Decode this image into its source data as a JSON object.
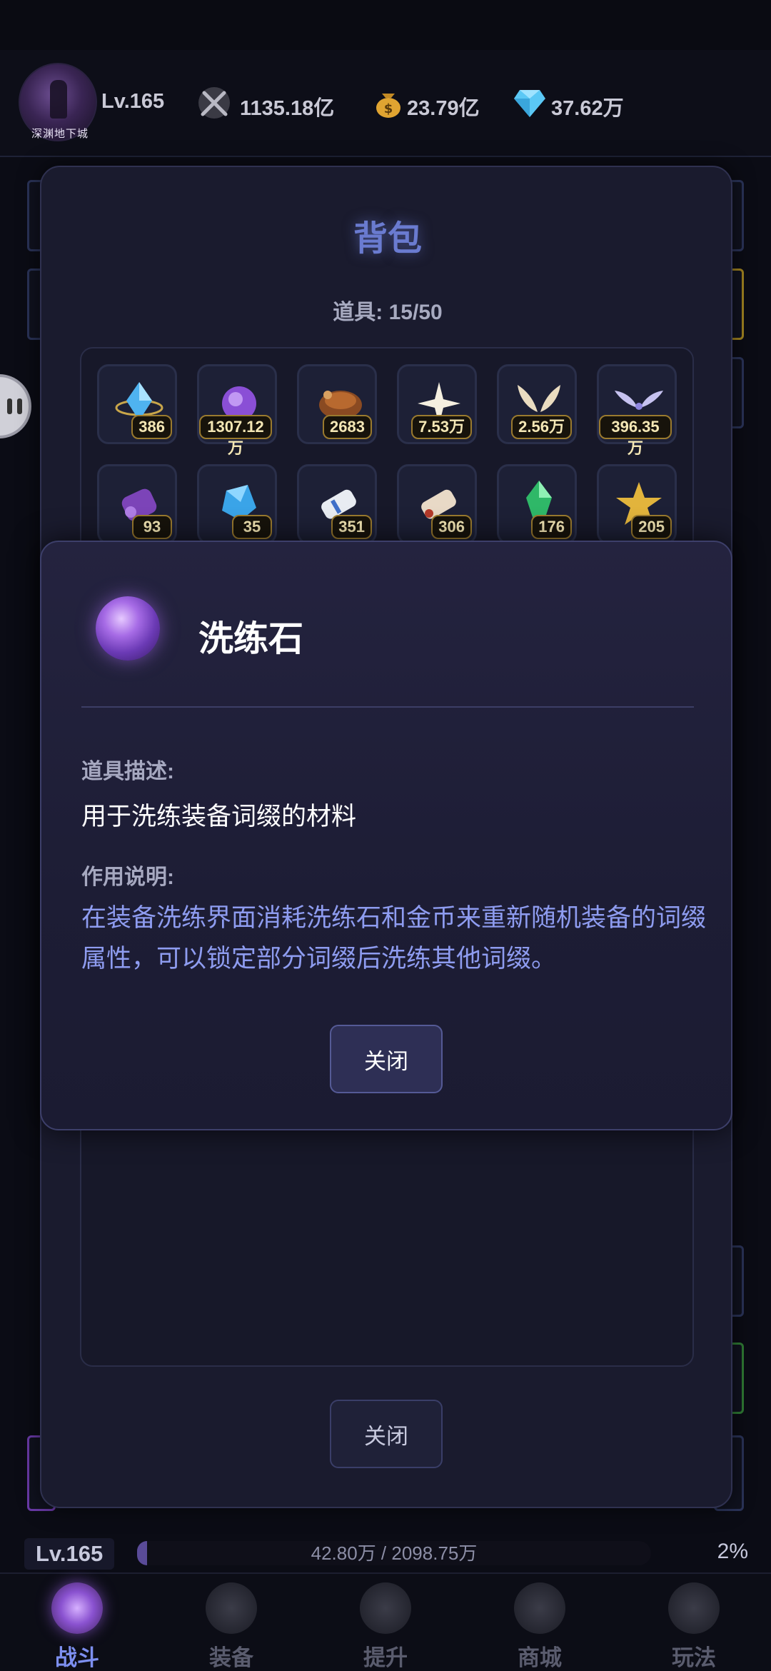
{
  "header": {
    "avatar_caption": "深渊地下城",
    "level": "Lv.165",
    "power": "1135.18亿",
    "gold": "23.79亿",
    "diamond": "37.62万"
  },
  "bag": {
    "title": "背包",
    "count_label": "道具: 15/50",
    "close_label": "关闭",
    "items": [
      {
        "name": "crystal-orb",
        "count": "386"
      },
      {
        "name": "refine-stone",
        "count": "1307.12万"
      },
      {
        "name": "treasure-chest",
        "count": "2683"
      },
      {
        "name": "star-shard",
        "count": "7.53万"
      },
      {
        "name": "golden-wings",
        "count": "2.56万"
      },
      {
        "name": "silver-wings",
        "count": "396.35万"
      },
      {
        "name": "purple-scroll",
        "count": "93"
      },
      {
        "name": "blue-crystal",
        "count": "35"
      },
      {
        "name": "white-scroll",
        "count": "351"
      },
      {
        "name": "red-scroll",
        "count": "306"
      },
      {
        "name": "green-gem",
        "count": "176"
      },
      {
        "name": "gold-star",
        "count": "205"
      }
    ]
  },
  "detail": {
    "name": "洗练石",
    "desc_label": "道具描述:",
    "desc": "用于洗练装备词缀的材料",
    "effect_label": "作用说明:",
    "effect": "在装备洗练界面消耗洗练石和金币来重新随机装备的词缀属性，可以锁定部分词缀后洗练其他词缀。",
    "close_label": "关闭"
  },
  "exp": {
    "level": "Lv.165",
    "text": "42.80万 / 2098.75万",
    "percent": "2%",
    "fraction": 0.02
  },
  "nav": {
    "items": [
      {
        "label": "战斗",
        "active": true
      },
      {
        "label": "装备",
        "active": false
      },
      {
        "label": "提升",
        "active": false
      },
      {
        "label": "商城",
        "active": false
      },
      {
        "label": "玩法",
        "active": false
      }
    ]
  },
  "colors": {
    "accent": "#7d8ff0",
    "count_border": "#9a7a2e",
    "effect_text": "#8e9cf0"
  }
}
